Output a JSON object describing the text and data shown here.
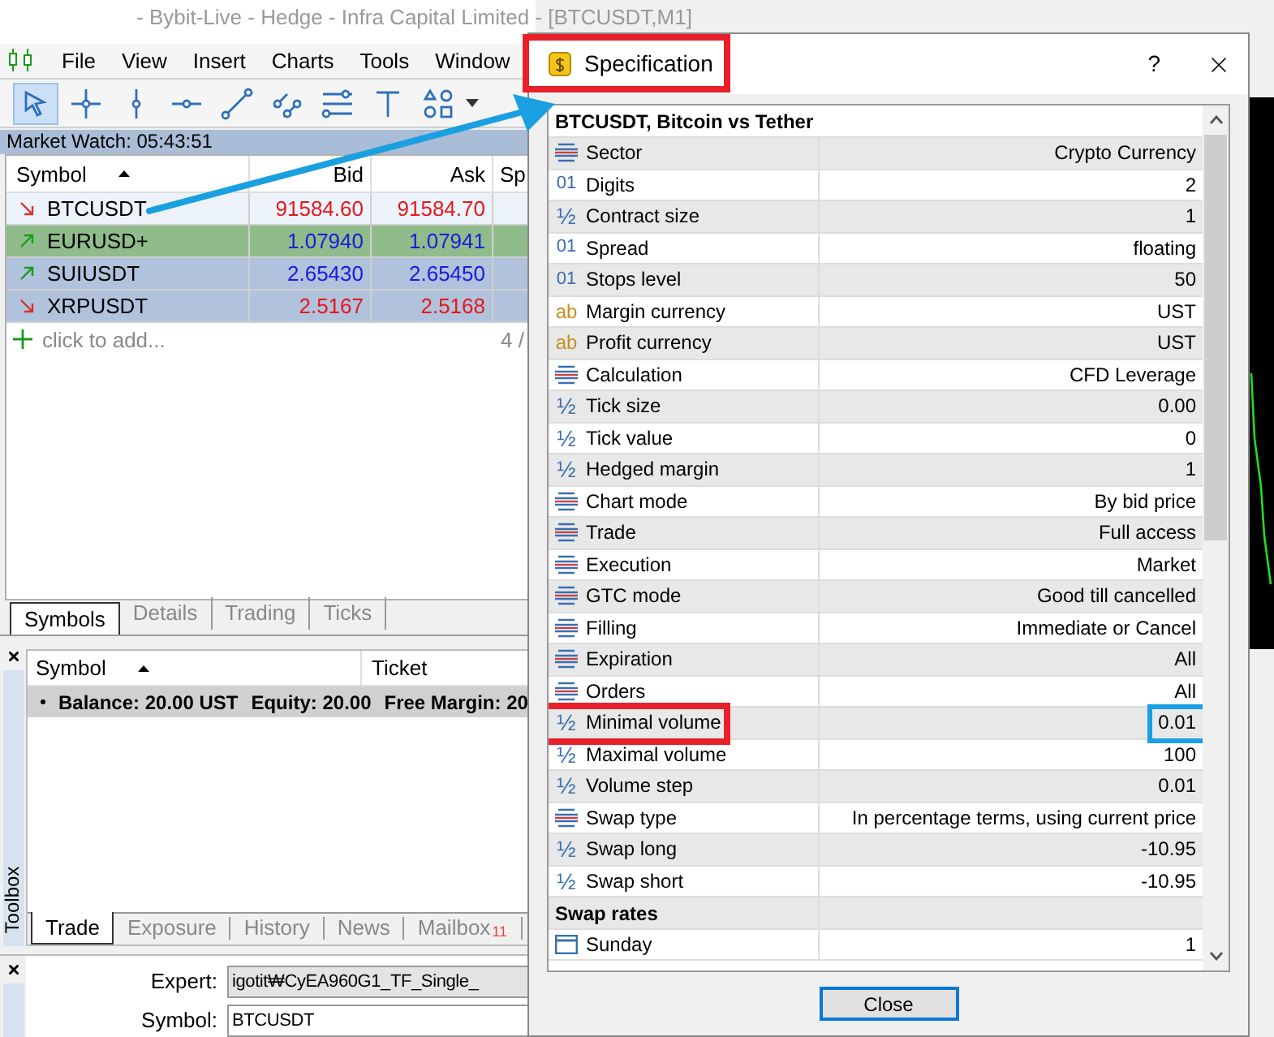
{
  "app": {
    "title": "- Bybit-Live - Hedge - Infra Capital Limited - [BTCUSDT,M1]",
    "menu": [
      "File",
      "View",
      "Insert",
      "Charts",
      "Tools",
      "Window"
    ],
    "toolbar": [
      {
        "kind": "cursor",
        "selected": true
      },
      {
        "kind": "crosshair",
        "selected": false
      },
      {
        "kind": "vline",
        "selected": false
      },
      {
        "kind": "hline",
        "selected": false
      },
      {
        "kind": "trend",
        "selected": false
      },
      {
        "kind": "channel",
        "selected": false
      },
      {
        "kind": "fibo",
        "selected": false
      },
      {
        "kind": "text",
        "selected": false
      },
      {
        "kind": "shapes",
        "selected": false
      }
    ]
  },
  "market_watch": {
    "title": "Market Watch: 05:43:51",
    "columns": [
      "Symbol",
      "Bid",
      "Ask",
      "Sp"
    ],
    "rows": [
      {
        "symbol": "BTCUSDT",
        "bid": "91584.60",
        "ask": "91584.70",
        "rising": false,
        "color": "#edf3fb"
      },
      {
        "symbol": "EURUSD+",
        "bid": "1.07940",
        "ask": "1.07941",
        "rising": true,
        "color": "#8fbc8a"
      },
      {
        "symbol": "SUIUSDT",
        "bid": "2.65430",
        "ask": "2.65450",
        "rising": true,
        "color": "#b0c2dc"
      },
      {
        "symbol": "XRPUSDT",
        "bid": "2.5167",
        "ask": "2.5168",
        "rising": false,
        "color": "#b0c2dc"
      }
    ],
    "add_row": "click to add...",
    "count": "4 /",
    "tabs": [
      {
        "label": "Symbols",
        "selected": true
      },
      {
        "label": "Details",
        "selected": false
      },
      {
        "label": "Trading",
        "selected": false
      },
      {
        "label": "Ticks",
        "selected": false
      }
    ]
  },
  "toolbox": {
    "label": "Toolbox",
    "columns": [
      "Symbol",
      "Ticket"
    ],
    "summary": [
      "Balance: 20.00 UST",
      "Equity: 20.00",
      "Free Margin: 20"
    ],
    "tabs": [
      {
        "label": "Trade",
        "selected": true
      },
      {
        "label": "Exposure",
        "selected": false
      },
      {
        "label": "History",
        "selected": false
      },
      {
        "label": "News",
        "selected": false
      },
      {
        "label": "Mailbox",
        "badge": "11",
        "selected": false
      }
    ]
  },
  "tester": {
    "fields": [
      {
        "label": "Expert:",
        "value": "igotit₩CyEA960G1_TF_Single_",
        "disabled": true
      },
      {
        "label": "Symbol:",
        "value": "BTCUSDT",
        "disabled": false
      }
    ]
  },
  "dialog": {
    "title": "Specification",
    "title_callout": true,
    "help": "?",
    "heading": "BTCUSDT, Bitcoin vs Tether",
    "rows": [
      {
        "kind": "list",
        "label": "Sector",
        "value": "Crypto Currency"
      },
      {
        "kind": "int",
        "icon": "01",
        "label": "Digits",
        "value": "2"
      },
      {
        "kind": "frac",
        "icon": "½",
        "label": "Contract size",
        "value": "1"
      },
      {
        "kind": "int",
        "icon": "01",
        "label": "Spread",
        "value": "floating"
      },
      {
        "kind": "int",
        "icon": "01",
        "label": "Stops level",
        "value": "50"
      },
      {
        "kind": "text",
        "icon": "ab",
        "label": "Margin currency",
        "value": "UST"
      },
      {
        "kind": "text",
        "icon": "ab",
        "label": "Profit currency",
        "value": "UST"
      },
      {
        "kind": "list",
        "label": "Calculation",
        "value": "CFD Leverage"
      },
      {
        "kind": "frac",
        "icon": "½",
        "label": "Tick size",
        "value": "0.00"
      },
      {
        "kind": "frac",
        "icon": "½",
        "label": "Tick value",
        "value": "0"
      },
      {
        "kind": "frac",
        "icon": "½",
        "label": "Hedged margin",
        "value": "1"
      },
      {
        "kind": "list",
        "label": "Chart mode",
        "value": "By bid price"
      },
      {
        "kind": "list",
        "label": "Trade",
        "value": "Full access"
      },
      {
        "kind": "list",
        "label": "Execution",
        "value": "Market"
      },
      {
        "kind": "list",
        "label": "GTC mode",
        "value": "Good till cancelled"
      },
      {
        "kind": "list",
        "label": "Filling",
        "value": "Immediate or Cancel"
      },
      {
        "kind": "list",
        "label": "Expiration",
        "value": "All"
      },
      {
        "kind": "list",
        "label": "Orders",
        "value": "All"
      },
      {
        "kind": "frac",
        "icon": "½",
        "label": "Minimal volume",
        "value": "0.01",
        "highlighted": true
      },
      {
        "kind": "frac",
        "icon": "½",
        "label": "Maximal volume",
        "value": "100"
      },
      {
        "kind": "frac",
        "icon": "½",
        "label": "Volume step",
        "value": "0.01"
      },
      {
        "kind": "list",
        "label": "Swap type",
        "value": "In percentage terms, using current price"
      },
      {
        "kind": "frac",
        "icon": "½",
        "label": "Swap long",
        "value": "-10.95"
      },
      {
        "kind": "frac",
        "icon": "½",
        "label": "Swap short",
        "value": "-10.95"
      },
      {
        "kind": "section",
        "label": "Swap rates"
      },
      {
        "kind": "date",
        "label": "Sunday",
        "value": "1"
      }
    ],
    "button": "Close"
  }
}
